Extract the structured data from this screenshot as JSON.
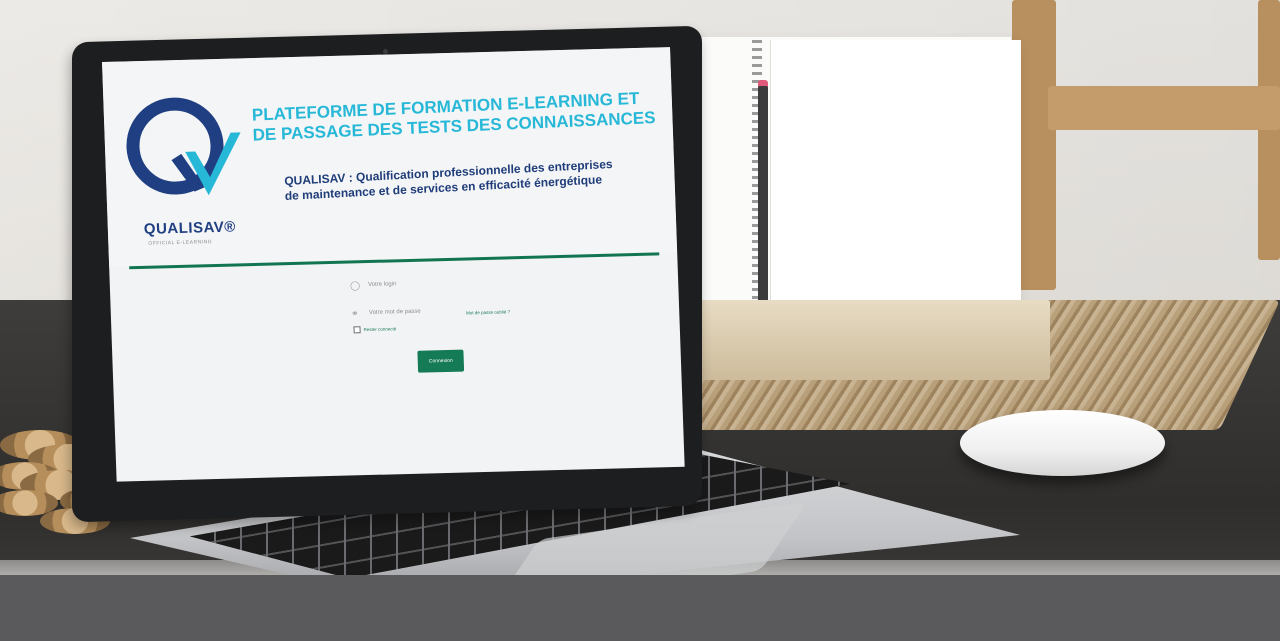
{
  "screen": {
    "title_line1": "PLATEFORME DE FORMATION E-LEARNING ET",
    "title_line2": "DE PASSAGE DES TESTS DES CONNAISSANCES",
    "subtitle_line1": "QUALISAV : Qualification professionnelle des entreprises",
    "subtitle_line2": "de maintenance  et de services en efficacité énergétique",
    "logo_text": "QUALISAV®",
    "logo_subtext": "OFFICIAL E-LEARNING",
    "login_placeholder": "Votre login",
    "password_placeholder": "Votre mot de passe",
    "remember_label": "Rester connecté",
    "forgot_label": "Mot de passe oublié ?",
    "submit_label": "Connexion"
  },
  "colors": {
    "accent_cyan": "#27b8d8",
    "brand_navy": "#1f3f82",
    "brand_green": "#157a56"
  },
  "icons": {
    "login": "user-icon",
    "password": "key-icon"
  }
}
